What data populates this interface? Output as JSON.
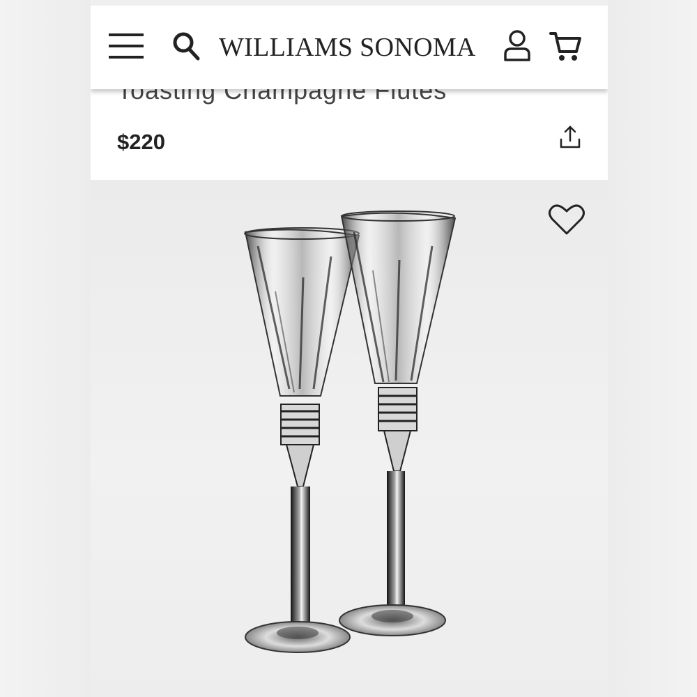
{
  "header": {
    "brand": "WILLIAMS SONOMA",
    "icons": {
      "menu": "hamburger-menu-icon",
      "search": "search-icon",
      "account": "user-account-icon",
      "cart": "shopping-cart-icon"
    }
  },
  "product": {
    "title": "Toasting Champagne Flutes",
    "price": "$220",
    "share_icon": "share-icon",
    "favorite_icon": "heart-icon",
    "image_subject": "champagne-flutes-pair"
  },
  "colors": {
    "text": "#222222",
    "background": "#ffffff",
    "hero_background": "#ececec"
  }
}
